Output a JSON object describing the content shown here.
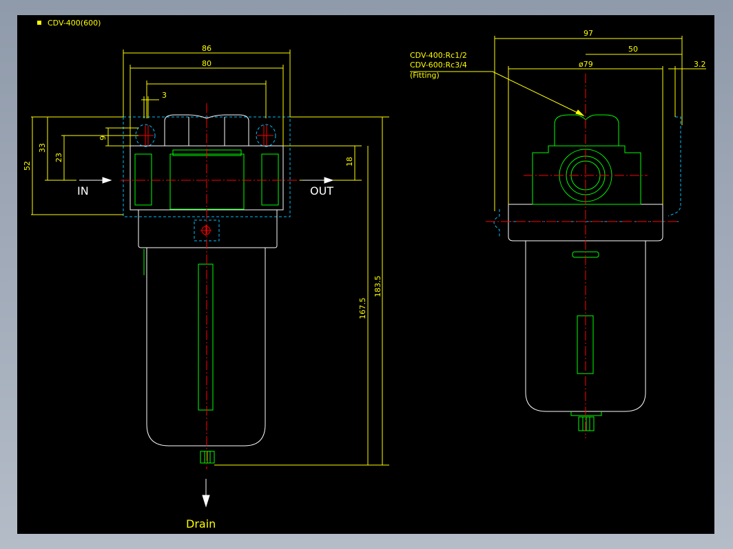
{
  "title": "CDV-400(600)",
  "colors": {
    "background": "#000000",
    "outline": "#ffffff",
    "part": "#00ff00",
    "dimension": "#ffff00",
    "centerline": "#ff0000",
    "hidden": "#00bfff"
  },
  "front_view": {
    "dims": {
      "width_86": "86",
      "width_80": "80",
      "offset_3": "3",
      "height_52": "52",
      "height_33": "33",
      "height_23": "23",
      "height_9": "9",
      "height_18": "18",
      "height_167_5": "167.5",
      "height_183_5": "183.5"
    },
    "port_in": "IN",
    "port_out": "OUT",
    "drain": "Drain"
  },
  "side_view": {
    "dims": {
      "width_97": "97",
      "width_50": "50",
      "diameter_79": "ø79",
      "offset_3_2": "3.2"
    },
    "fitting_note": [
      "CDV-400:Rc1/2",
      "CDV-600:Rc3/4",
      "(Fitting)"
    ]
  }
}
